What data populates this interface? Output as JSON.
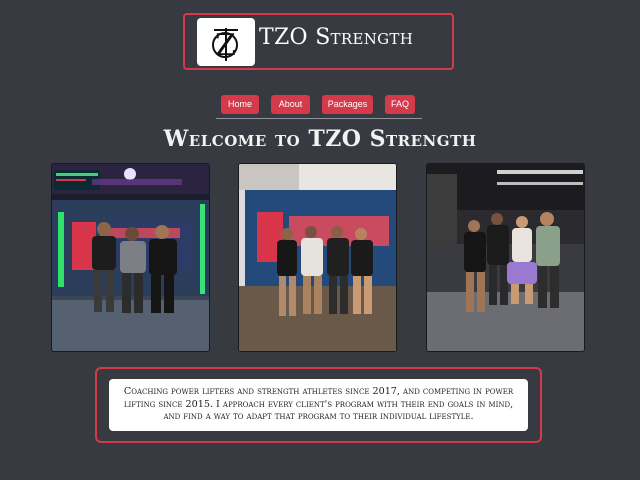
{
  "brand": {
    "name": "TZO Strength",
    "logo_icon": "tzo-monogram-icon"
  },
  "nav": {
    "items": [
      {
        "label": "Home"
      },
      {
        "label": "About"
      },
      {
        "label": "Packages"
      },
      {
        "label": "FAQ"
      }
    ]
  },
  "main": {
    "heading": "Welcome to TZO Strength",
    "photos": [
      {
        "subject": "three-lifters-photo"
      },
      {
        "subject": "medalists-photo"
      },
      {
        "subject": "gym-group-photo"
      }
    ],
    "about_text": "Coaching power lifters and strength athletes since 2017, and competing in power lifting since 2015. I approach every client's program with their end goals in mind, and find a way to adapt that program to their individual lifestyle."
  },
  "colors": {
    "background": "#373a40",
    "accent": "#d43a4a",
    "text": "#ffffff"
  }
}
